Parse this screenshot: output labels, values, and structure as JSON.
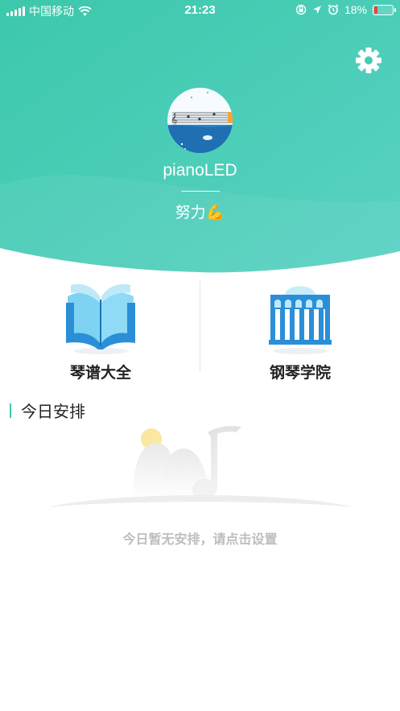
{
  "status_bar": {
    "carrier": "中国移动",
    "time": "21:23",
    "battery_percent": "18%",
    "battery_level": 0.18,
    "icons": [
      "signal-icon",
      "wifi-icon",
      "orientation-lock-icon",
      "location-icon",
      "alarm-icon",
      "battery-icon"
    ]
  },
  "colors": {
    "header_gradient_start": "#3dc9ad",
    "header_gradient_end": "#58d3c3",
    "accent": "#3fc8b3",
    "icon_blue": "#2c8fd6"
  },
  "profile": {
    "username": "pianoLED",
    "motto": "努力💪"
  },
  "entries": {
    "score_library": {
      "label": "琴谱大全",
      "icon": "open-book-icon"
    },
    "piano_academy": {
      "label": "钢琴学院",
      "icon": "academy-building-icon"
    }
  },
  "schedule": {
    "title": "今日安排",
    "empty_message": "今日暂无安排，请点击设置"
  },
  "settings": {
    "icon": "gear-icon"
  }
}
